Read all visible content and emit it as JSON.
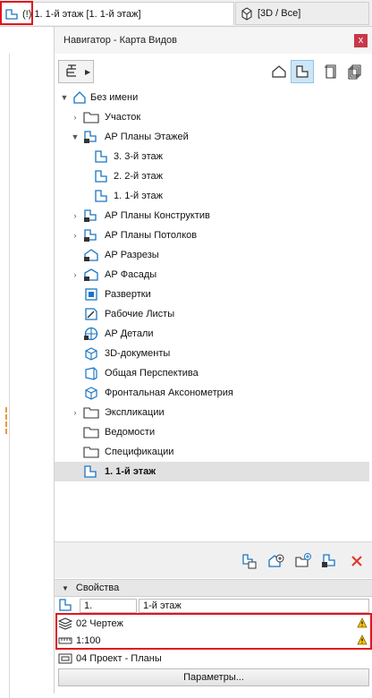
{
  "tabs": [
    {
      "label": "(!) 1. 1-й этаж [1. 1-й этаж]",
      "icon": "floor-plan-icon",
      "active": true
    },
    {
      "label": "[3D / Все]",
      "icon": "3d-view-icon",
      "active": false
    }
  ],
  "panel": {
    "title": "Навигатор - Карта Видов",
    "close": "x"
  },
  "view_buttons": [
    "project-map-icon",
    "view-map-icon",
    "layout-book-icon",
    "publisher-sets-icon"
  ],
  "tree": {
    "root": "Без имени",
    "items": [
      {
        "label": "Участок"
      },
      {
        "label": "АР Планы Этажей"
      },
      {
        "label": "3. 3-й этаж"
      },
      {
        "label": "2. 2-й этаж"
      },
      {
        "label": "1. 1-й этаж"
      },
      {
        "label": "АР Планы Конструктив"
      },
      {
        "label": "АР Планы Потолков"
      },
      {
        "label": "АР Разрезы"
      },
      {
        "label": "АР Фасады"
      },
      {
        "label": "Развертки"
      },
      {
        "label": "Рабочие Листы"
      },
      {
        "label": "АР Детали"
      },
      {
        "label": "3D-документы"
      },
      {
        "label": "Общая Перспектива"
      },
      {
        "label": "Фронтальная Аксонометрия"
      },
      {
        "label": "Экспликации"
      },
      {
        "label": "Ведомости"
      },
      {
        "label": "Спецификации"
      },
      {
        "label": "1. 1-й этаж"
      }
    ]
  },
  "properties": {
    "header": "Свойства",
    "id_value": "1.",
    "name_value": "1-й этаж",
    "layer_combo": "02 Чертеж",
    "scale": "1:100",
    "model_view": "04 Проект - Планы",
    "params_button": "Параметры..."
  },
  "colors": {
    "highlight": "#e0151e",
    "accent": "#1a75c4",
    "selected_bg": "#e1e1e1",
    "warning": "#f4c20d"
  }
}
